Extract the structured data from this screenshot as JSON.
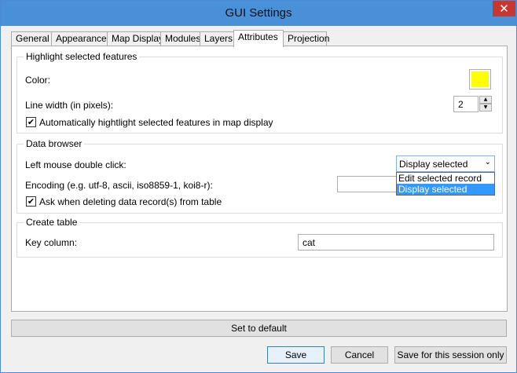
{
  "window": {
    "title": "GUI Settings",
    "close_glyph": "✕"
  },
  "tabs": [
    {
      "label": "General"
    },
    {
      "label": "Appearance"
    },
    {
      "label": "Map Display"
    },
    {
      "label": "Modules"
    },
    {
      "label": "Layers"
    },
    {
      "label": "Attributes",
      "active": true
    },
    {
      "label": "Projection"
    }
  ],
  "highlight": {
    "title": "Highlight selected features",
    "color_label": "Color:",
    "color_value": "#ffff00",
    "line_width_label": "Line width (in pixels):",
    "line_width_value": "2",
    "auto_highlight_label": "Automatically hightlight selected features in map display",
    "auto_highlight_checked": true
  },
  "data_browser": {
    "title": "Data browser",
    "double_click_label": "Left mouse double click:",
    "double_click_value": "Display selected",
    "double_click_options": [
      "Edit selected record",
      "Display selected"
    ],
    "encoding_label": "Encoding (e.g. utf-8, ascii, iso8859-1, koi8-r):",
    "encoding_value": "",
    "ask_delete_label": "Ask when deleting data record(s) from table",
    "ask_delete_checked": true
  },
  "create_table": {
    "title": "Create table",
    "key_column_label": "Key column:",
    "key_column_value": "cat"
  },
  "buttons": {
    "set_default": "Set to default",
    "save": "Save",
    "cancel": "Cancel",
    "save_session": "Save for this session only"
  },
  "glyphs": {
    "check": "✔",
    "up": "▲",
    "down": "▼",
    "chevron": "⌄"
  }
}
